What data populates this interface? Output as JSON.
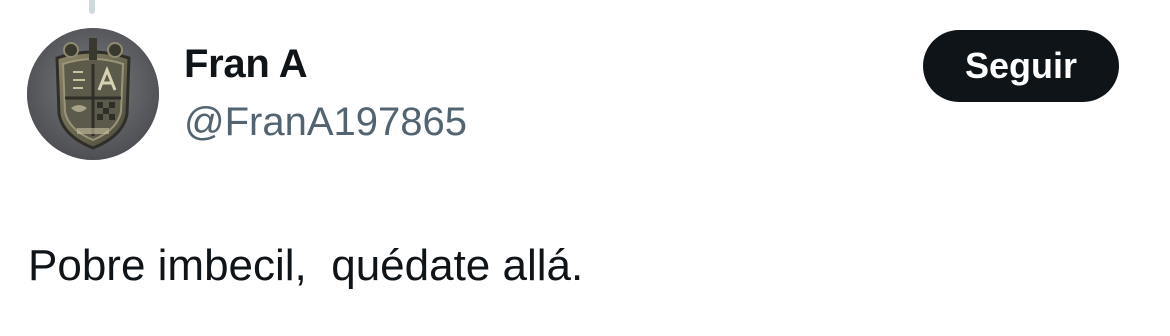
{
  "tweet": {
    "author": {
      "display_name": "Fran A",
      "handle": "@FranA197865",
      "avatar_icon": "coat-of-arms-avatar"
    },
    "follow_label": "Seguir",
    "text": "Pobre imbecil,  quédate allá."
  },
  "colors": {
    "text_primary": "#0f1419",
    "text_secondary": "#536471",
    "button_bg": "#0f1419",
    "button_text": "#ffffff",
    "thread_line": "#cfd9de"
  }
}
